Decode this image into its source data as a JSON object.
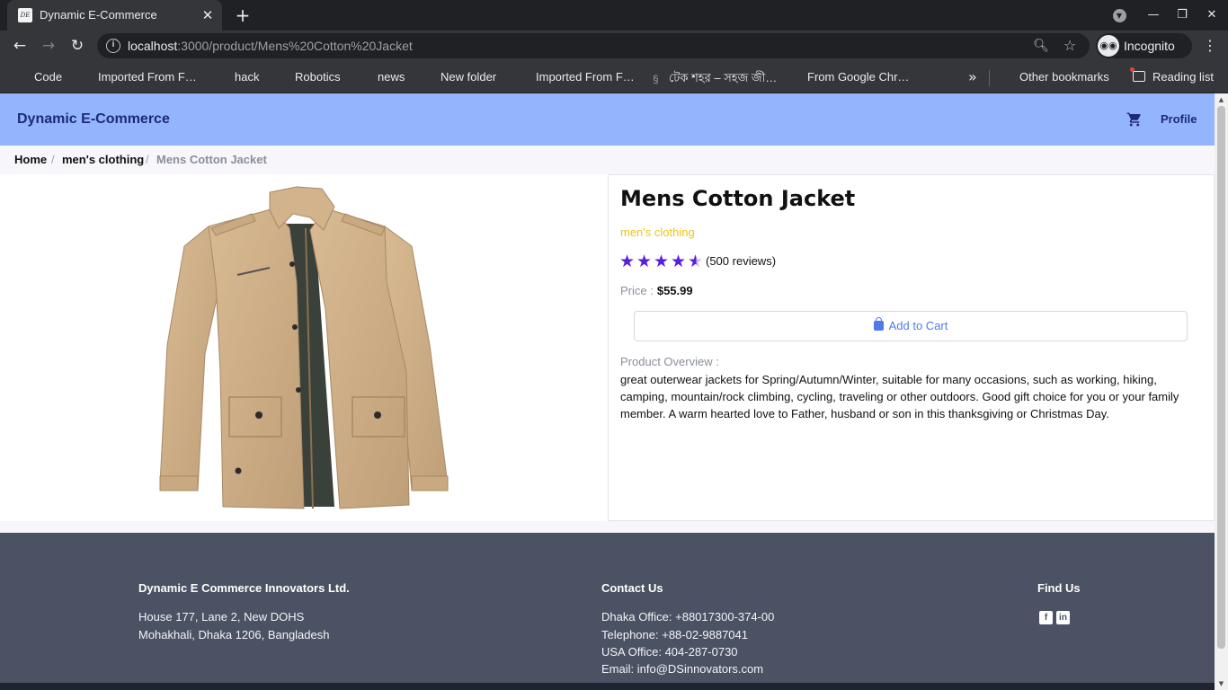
{
  "browser": {
    "tab_title": "Dynamic E-Commerce",
    "tab_favicon_text": "DE",
    "url_host": "localhost",
    "url_path": ":3000/product/Mens%20Cotton%20Jacket",
    "incognito_label": "Incognito",
    "bookmarks": [
      "Code",
      "Imported From F…",
      "hack",
      "Robotics",
      "news",
      "New folder",
      "Imported From F…",
      "টেক শহর – সহজ জী…",
      "From Google Chr…"
    ],
    "other_bookmarks": "Other bookmarks",
    "reading_list": "Reading list"
  },
  "navbar": {
    "brand": "Dynamic E-Commerce",
    "profile": "Profile"
  },
  "breadcrumb": {
    "home": "Home",
    "category": "men's clothing",
    "current": "Mens Cotton Jacket",
    "separator": "/"
  },
  "product": {
    "title": "Mens Cotton Jacket",
    "category": "men's clothing",
    "rating": 4.5,
    "rating_max": 5,
    "reviews": "(500 reviews)",
    "price_label": "Price :",
    "price": "$55.99",
    "add_to_cart": "Add to Cart",
    "overview_label": "Product Overview :",
    "overview": "great outerwear jackets for Spring/Autumn/Winter, suitable for many occasions, such as working, hiking, camping, mountain/rock climbing, cycling, traveling or other outdoors. Good gift choice for you or your family member. A warm hearted love to Father, husband or son in this thanksgiving or Christmas Day."
  },
  "footer": {
    "company": {
      "heading": "Dynamic E Commerce Innovators Ltd.",
      "address1": "House 177, Lane 2, New DOHS",
      "address2": "Mohakhali, Dhaka 1206, Bangladesh"
    },
    "contact": {
      "heading": "Contact Us",
      "dhaka": "Dhaka Office: +88017300-374-00",
      "telephone": "Telephone: +88-02-9887041",
      "usa": "USA Office: 404-287-0730",
      "email": "Email: info@DSinnovators.com"
    },
    "find_us": {
      "heading": "Find Us"
    }
  },
  "colors": {
    "navbar_bg": "#93b5fd",
    "brand_text": "#1e2a78",
    "star": "#5b1de0",
    "category": "#f0c419",
    "cart_button_text": "#4f7be8",
    "footer_bg": "#4b5264"
  },
  "icons": {
    "cart": "cart-icon",
    "bag": "shopping-bag-icon",
    "facebook": "facebook-icon",
    "linkedin": "linkedin-icon",
    "star": "star-icon"
  }
}
